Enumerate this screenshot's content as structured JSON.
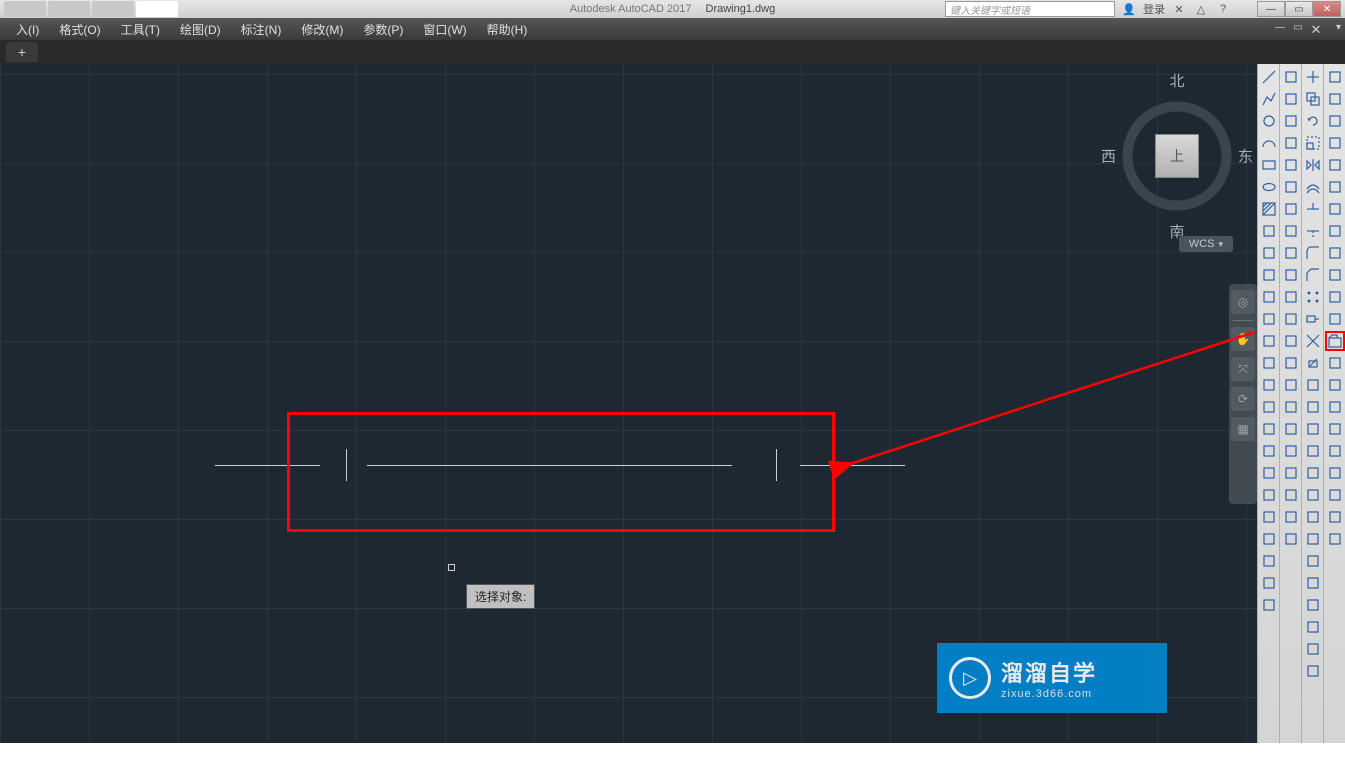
{
  "app": {
    "name": "Autodesk AutoCAD 2017",
    "document": "Drawing1.dwg"
  },
  "search": {
    "placeholder": "键入关键字或短语"
  },
  "login": {
    "label": "登录"
  },
  "menus": [
    {
      "label": "入(I)"
    },
    {
      "label": "格式(O)"
    },
    {
      "label": "工具(T)"
    },
    {
      "label": "绘图(D)"
    },
    {
      "label": "标注(N)"
    },
    {
      "label": "修改(M)"
    },
    {
      "label": "参数(P)"
    },
    {
      "label": "窗口(W)"
    },
    {
      "label": "帮助(H)"
    }
  ],
  "viewcube": {
    "north": "北",
    "south": "南",
    "east": "东",
    "west": "西",
    "face": "上"
  },
  "wcs": {
    "label": "WCS"
  },
  "tooltip": {
    "select_object": "选择对象:"
  },
  "watermark": {
    "title": "溜溜自学",
    "url": "zixue.3d66.com"
  },
  "toolbars": {
    "col1": [
      "line",
      "polyline",
      "circle",
      "arc",
      "rectangle",
      "ellipse",
      "hatch",
      "spline",
      "construction",
      "point",
      "region",
      "table",
      "mtext",
      "revcloud",
      "polygon",
      "divide",
      "donut",
      "ray",
      "block",
      "insert",
      "helix",
      "3dpoly",
      "boundary",
      "wipeout",
      "gradient"
    ],
    "col2": [
      "dim-linear",
      "dim-aligned",
      "dim-angular",
      "dim-arc",
      "dim-radius",
      "dim-diameter",
      "dim-ordinate",
      "dim-jogged",
      "dim-baseline",
      "dim-continue",
      "dim-space",
      "dim-break",
      "tolerance",
      "centerline",
      "inspect",
      "dim-oblique",
      "dim-edit",
      "dim-update",
      "dimstyle",
      "mleader",
      "qleader",
      "dim-reassoc"
    ],
    "col3": [
      "move",
      "copy",
      "rotate",
      "scale",
      "mirror",
      "offset",
      "trim",
      "extend",
      "fillet",
      "chamfer",
      "array",
      "stretch",
      "explode",
      "erase",
      "join",
      "break",
      "align",
      "lengthen",
      "pedit",
      "matchprop",
      "hatchedit",
      "blockedit",
      "blend",
      "reverse",
      "overkill",
      "group",
      "ungroup",
      "draworder"
    ],
    "col4": [
      "redraw",
      "regen",
      "zoom-win",
      "zoom-ext",
      "zoom-prev",
      "pan",
      "layer",
      "properties",
      "qselect",
      "design-center",
      "tool-palette",
      "measure",
      "open",
      "dist",
      "area",
      "list",
      "id",
      "time",
      "status",
      "setvar",
      "purge",
      "audit"
    ]
  }
}
